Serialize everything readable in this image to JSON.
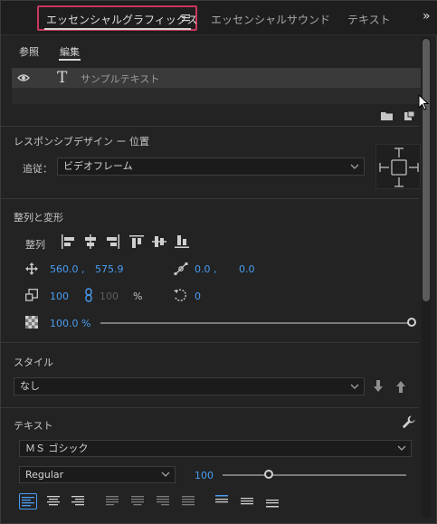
{
  "tabs": {
    "essential_graphics": "エッセンシャルグラフィックス",
    "menu_icon": "hamburger-icon",
    "essential_sound": "エッセンシャルサウンド",
    "text": "テキスト",
    "overflow": "»"
  },
  "subtabs": {
    "browse": "参照",
    "edit": "編集"
  },
  "layer": {
    "name": "サンプルテキスト",
    "type_glyph": "T"
  },
  "responsive": {
    "title": "レスポンシブデザイン ー 位置",
    "follow_label": "追従：",
    "follow_value": "ビデオフレーム"
  },
  "align_transform": {
    "title": "整列と変形",
    "align_label": "整列",
    "position_x": "560.0 ,",
    "position_y": "575.9",
    "anchor_x": "0.0 ,",
    "anchor_y": "0.0",
    "scale": "100",
    "scale_linked": "100",
    "scale_unit": "%",
    "rotation": "0",
    "opacity": "100.0 %",
    "opacity_fraction": 1.0
  },
  "style": {
    "title": "スタイル",
    "value": "なし"
  },
  "text": {
    "title": "テキスト",
    "font": "ＭＳ ゴシック",
    "font_style": "Regular",
    "font_size": "100",
    "font_size_fraction": 0.25
  },
  "colors": {
    "accent_blue": "#4a9df3",
    "highlight_border": "#c8375c"
  }
}
